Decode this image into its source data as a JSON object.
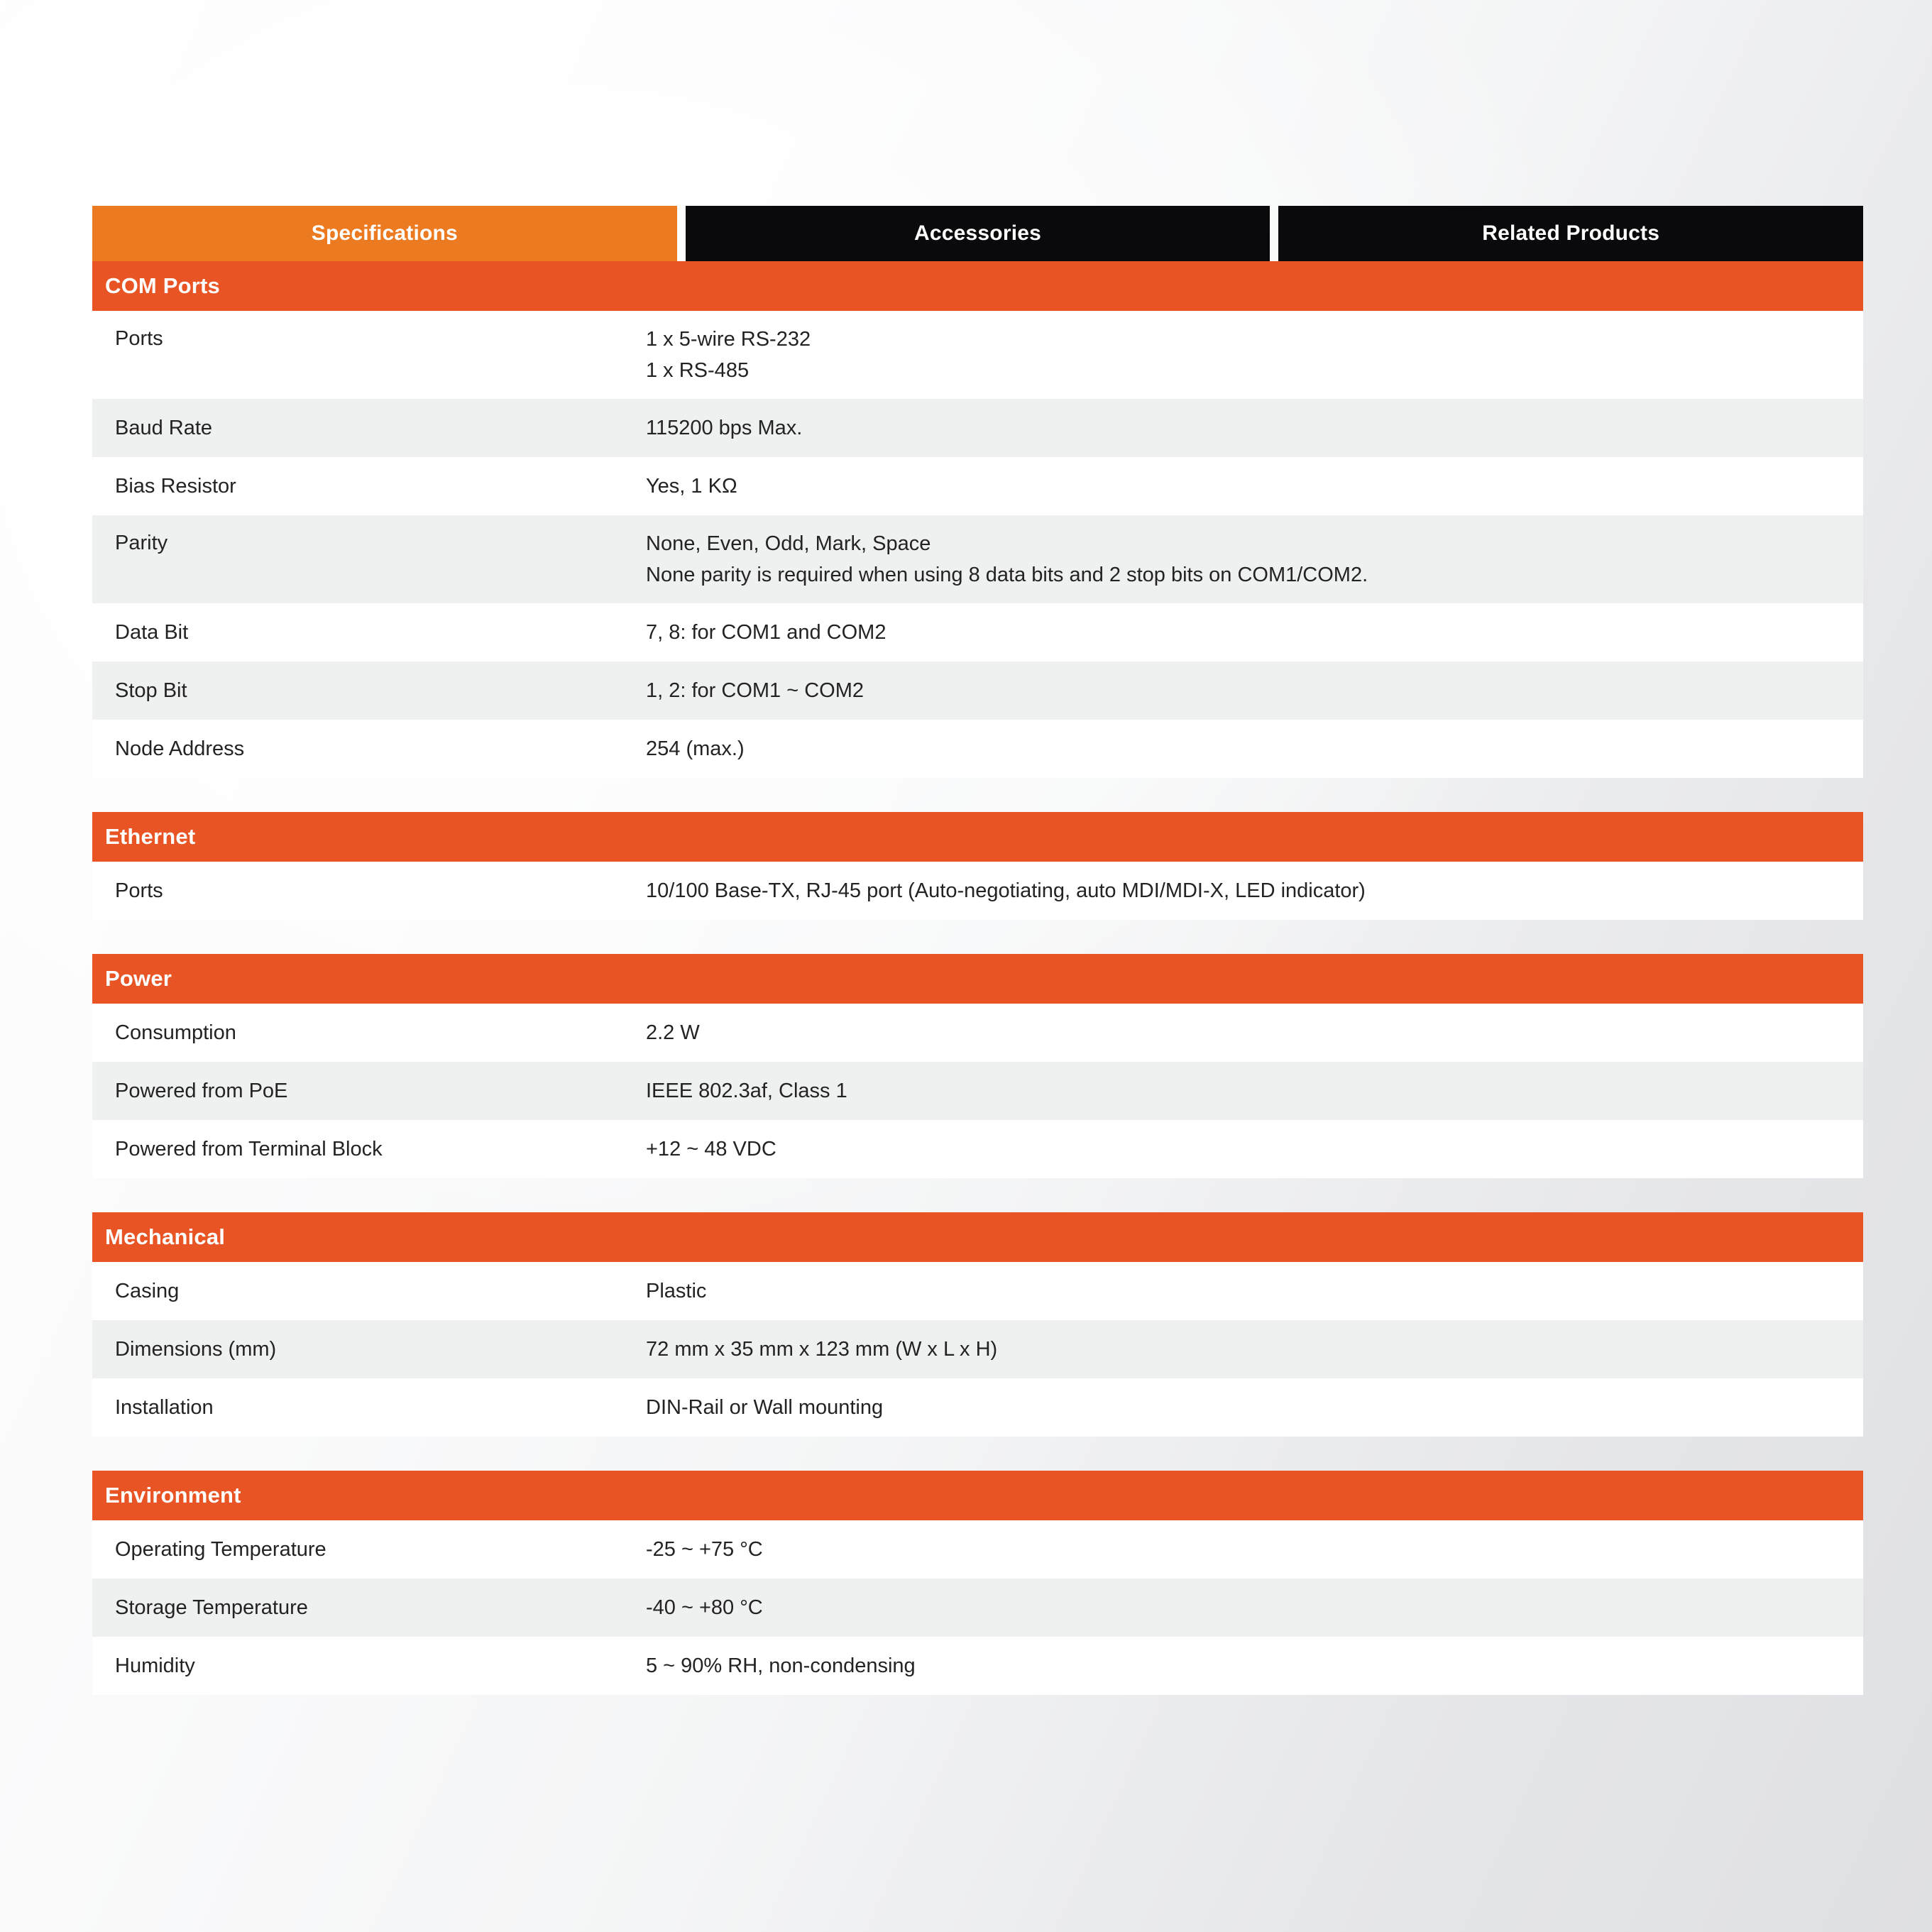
{
  "tabs": [
    {
      "label": "Specifications",
      "active": true
    },
    {
      "label": "Accessories",
      "active": false
    },
    {
      "label": "Related Products",
      "active": false
    }
  ],
  "colors": {
    "tab_active": "#EC7A21",
    "tab_inactive": "#0A0A0C",
    "section_header": "#E95425",
    "row_alt": "#EFF0F0",
    "row_base": "#FFFFFF",
    "text": "#232323"
  },
  "sections": [
    {
      "title": "COM Ports",
      "rows": [
        {
          "label": "Ports",
          "value_lines": [
            "1 x 5-wire RS-232",
            "1 x RS-485"
          ]
        },
        {
          "label": "Baud Rate",
          "value_lines": [
            "115200 bps Max."
          ]
        },
        {
          "label": "Bias Resistor",
          "value_lines": [
            "Yes, 1 KΩ"
          ]
        },
        {
          "label": "Parity",
          "value_lines": [
            "None, Even, Odd, Mark, Space",
            "None parity is required when using 8 data bits and 2 stop bits on COM1/COM2."
          ]
        },
        {
          "label": "Data Bit",
          "value_lines": [
            "7, 8: for COM1 and COM2"
          ]
        },
        {
          "label": "Stop Bit",
          "value_lines": [
            "1, 2: for COM1 ~ COM2"
          ]
        },
        {
          "label": "Node Address",
          "value_lines": [
            "254 (max.)"
          ]
        }
      ]
    },
    {
      "title": "Ethernet",
      "rows": [
        {
          "label": "Ports",
          "value_lines": [
            "10/100 Base-TX, RJ-45 port (Auto-negotiating, auto MDI/MDI-X, LED indicator)"
          ]
        }
      ]
    },
    {
      "title": "Power",
      "rows": [
        {
          "label": "Consumption",
          "value_lines": [
            "2.2 W"
          ]
        },
        {
          "label": "Powered from PoE",
          "value_lines": [
            "IEEE 802.3af, Class 1"
          ]
        },
        {
          "label": "Powered from Terminal Block",
          "value_lines": [
            "+12 ~ 48 VDC"
          ]
        }
      ]
    },
    {
      "title": "Mechanical",
      "rows": [
        {
          "label": "Casing",
          "value_lines": [
            "Plastic"
          ]
        },
        {
          "label": "Dimensions (mm)",
          "value_lines": [
            "72 mm x 35 mm x 123 mm (W x L x H)"
          ]
        },
        {
          "label": "Installation",
          "value_lines": [
            "DIN-Rail or Wall mounting"
          ]
        }
      ]
    },
    {
      "title": "Environment",
      "rows": [
        {
          "label": "Operating Temperature",
          "value_lines": [
            "-25 ~ +75 °C"
          ]
        },
        {
          "label": "Storage Temperature",
          "value_lines": [
            "-40 ~ +80 °C"
          ]
        },
        {
          "label": "Humidity",
          "value_lines": [
            "5 ~ 90% RH, non-condensing"
          ]
        }
      ]
    }
  ]
}
